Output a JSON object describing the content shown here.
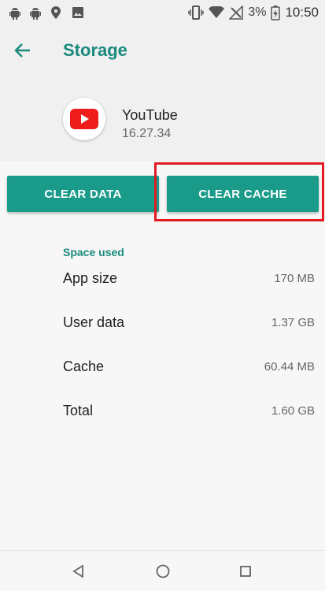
{
  "status_bar": {
    "battery_percent": "3%",
    "time": "10:50",
    "icons": [
      "android-robot-icon",
      "android-robot-icon",
      "location-icon",
      "image-icon",
      "vibrate-icon",
      "wifi-icon",
      "no-signal-icon",
      "battery-charging-icon"
    ]
  },
  "header": {
    "title": "Storage",
    "back_icon": "arrow-left-icon"
  },
  "app": {
    "name": "YouTube",
    "version": "16.27.34",
    "icon": "youtube-icon"
  },
  "actions": {
    "clear_data": "CLEAR DATA",
    "clear_cache": "CLEAR CACHE"
  },
  "space_used": {
    "label": "Space used",
    "rows": [
      {
        "label": "App size",
        "value": "170 MB"
      },
      {
        "label": "User data",
        "value": "1.37 GB"
      },
      {
        "label": "Cache",
        "value": "60.44 MB"
      },
      {
        "label": "Total",
        "value": "1.60 GB"
      }
    ]
  },
  "colors": {
    "accent": "#1b8a7d",
    "button": "#1a9a89",
    "highlight": "#e21b23"
  },
  "nav_bar": {
    "icons": [
      "back-triangle-icon",
      "home-circle-icon",
      "recents-square-icon"
    ]
  }
}
